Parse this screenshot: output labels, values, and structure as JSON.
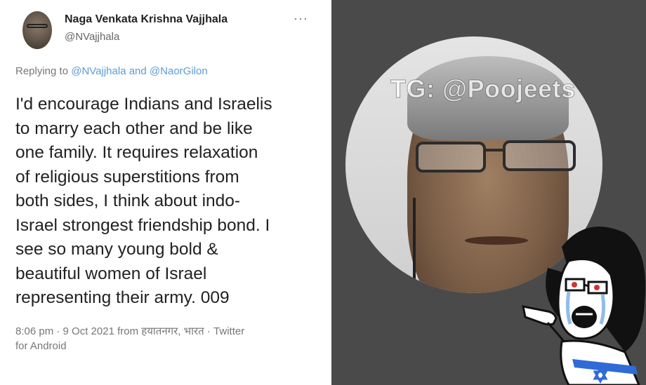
{
  "tweet": {
    "display_name": "Naga Venkata Krishna Vajjhala",
    "handle": "@NVajjhala",
    "more_label": "···",
    "replying_prefix": "Replying to",
    "replying_mention_1": "@NVajjhala",
    "replying_and": "and",
    "replying_mention_2": "@NaorGilon",
    "text": "I'd encourage Indians and Israelis\nto marry each other and be like\none family. It requires relaxation\nof religious superstitions from\nboth sides, I think about indo-\nIsrael strongest friendship bond. I\nsee so many young bold &\nbeautiful women of Israel\nrepresenting their army. 009",
    "meta_line1": "8:06 pm · 9 Oct 2021 from हयातनगर, भारत · Twitter",
    "meta_line2": "for Android"
  },
  "photo": {
    "watermark": "TG: @Poojeets"
  },
  "colors": {
    "right_panel_bg": "#4a4a4a",
    "mention_blue": "#5b9bd5",
    "meta_gray": "#777777"
  }
}
